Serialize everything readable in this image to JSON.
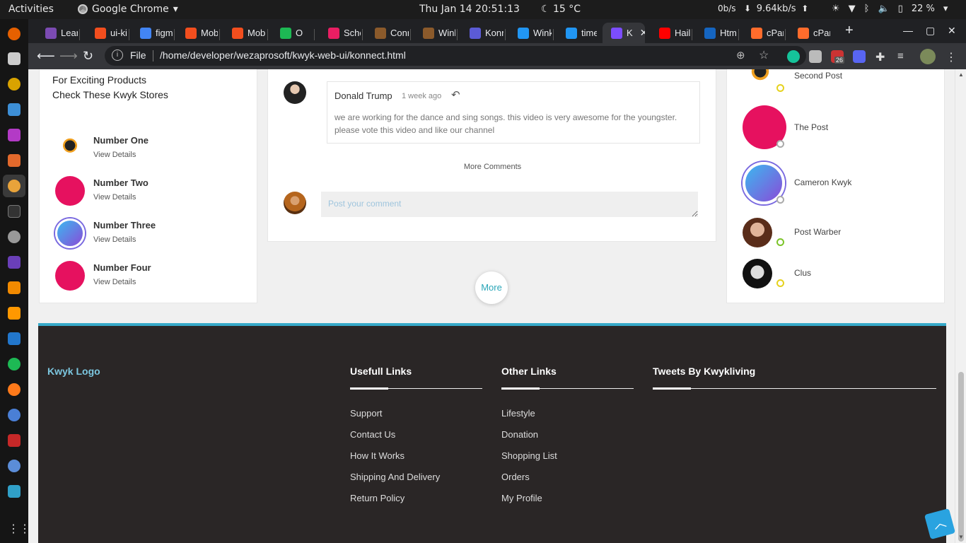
{
  "system_bar": {
    "activities": "Activities",
    "app_name": "Google Chrome",
    "datetime": "Thu Jan 14  20:51:13",
    "weather": "15 °C",
    "net_up": "0b/s",
    "net_down": "9.64kb/s",
    "battery": "22 %"
  },
  "browser": {
    "tabs": [
      {
        "label": "Learn",
        "color": "#7b4bb3"
      },
      {
        "label": "ui-kit",
        "color": "#f24e1e"
      },
      {
        "label": "figma",
        "color": "#4285f4"
      },
      {
        "label": "Mobi",
        "color": "#f24e1e"
      },
      {
        "label": "Mobi",
        "color": "#f24e1e"
      },
      {
        "label": "O",
        "color": "#1db954"
      },
      {
        "label": "Scho",
        "color": "#e91e63"
      },
      {
        "label": "Conn",
        "color": "#8b5a2b"
      },
      {
        "label": "Wink",
        "color": "#8b5a2b"
      },
      {
        "label": "Konn",
        "color": "#5b5bd6"
      },
      {
        "label": "Wink",
        "color": "#2196f3"
      },
      {
        "label": "time",
        "color": "#2196f3"
      },
      {
        "label": "K",
        "color": "#7c4dff"
      },
      {
        "label": "Haile",
        "color": "#ff0000"
      },
      {
        "label": "Html",
        "color": "#1565c0"
      },
      {
        "label": "cPan",
        "color": "#ff6c2c"
      },
      {
        "label": "cPan",
        "color": "#ff6c2c"
      }
    ],
    "scheme": "File",
    "url": "/home/developer/wezaprosoft/kwyk-web-ui/konnect.html",
    "ext_badge": "26"
  },
  "left_panel": {
    "intro_line1": "For Exciting Products",
    "intro_line2": "Check These Kwyk Stores",
    "stores": [
      {
        "name": "Number One",
        "details": "View Details"
      },
      {
        "name": "Number Two",
        "details": "View Details"
      },
      {
        "name": "Number Three",
        "details": "View Details"
      },
      {
        "name": "Number Four",
        "details": "View Details"
      }
    ]
  },
  "comments": {
    "author": "Donald Trump",
    "time": "1 week ago",
    "text": "we are working for the dance and sing songs. this video is very awesome for the youngster. please vote this video and like our channel",
    "more_comments": "More Comments",
    "input_placeholder": "Post your comment",
    "more_button": "More"
  },
  "right_panel": {
    "friends": [
      {
        "name": "Second Post"
      },
      {
        "name": "The Post"
      },
      {
        "name": "Cameron Kwyk"
      },
      {
        "name": "Post Warber"
      },
      {
        "name": "Clus"
      }
    ]
  },
  "footer": {
    "logo": "Kwyk Logo",
    "useful_links": {
      "title": "Usefull Links",
      "items": [
        "Support",
        "Contact Us",
        "How It Works",
        "Shipping And Delivery",
        "Return Policy"
      ]
    },
    "other_links": {
      "title": "Other Links",
      "items": [
        "Lifestyle",
        "Donation",
        "Shopping List",
        "Orders",
        "My Profile"
      ]
    },
    "tweets": {
      "title": "Tweets By Kwykliving"
    }
  },
  "colors": {
    "accent": "#2aa6b8",
    "footer_bg": "#2a2626",
    "footer_border": "#36a9c9",
    "online_dot": "#7cc42a",
    "away_dot": "#e6d21e",
    "offline_dot": "#aaaaaa"
  }
}
